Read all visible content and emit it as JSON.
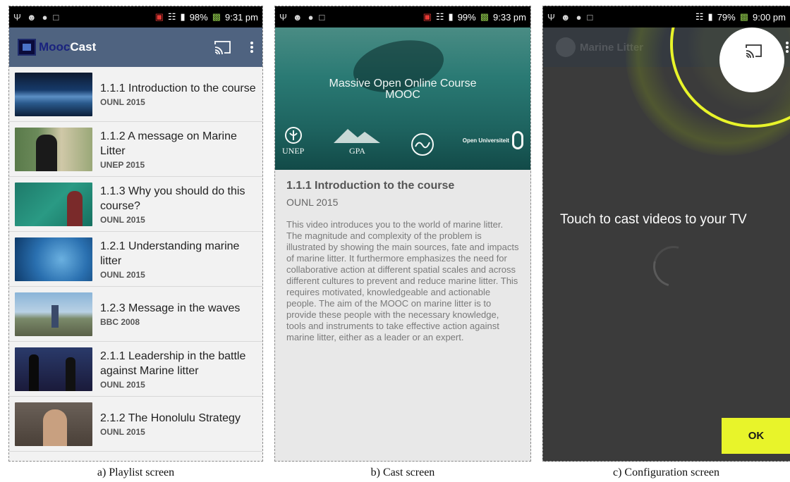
{
  "screens": {
    "playlist": {
      "status": {
        "battery": "98%",
        "time": "9:31 pm"
      },
      "app": {
        "name_part1": "Mooc",
        "name_part2": "Cast"
      },
      "items": [
        {
          "title": "1.1.1 Introduction to the course",
          "source": "OUNL 2015"
        },
        {
          "title": "1.1.2 A message on Marine Litter",
          "source": "UNEP 2015"
        },
        {
          "title": "1.1.3 Why you should do this course?",
          "source": "OUNL 2015"
        },
        {
          "title": "1.2.1 Understanding marine litter",
          "source": "OUNL 2015"
        },
        {
          "title": "1.2.3 Message in the waves",
          "source": "BBC 2008"
        },
        {
          "title": "2.1.1 Leadership in the battle against Marine litter",
          "source": "OUNL 2015"
        },
        {
          "title": "2.1.2 The Honolulu Strategy",
          "source": "OUNL 2015"
        }
      ]
    },
    "cast": {
      "status": {
        "battery": "99%",
        "time": "9:33 pm"
      },
      "hero": {
        "title_line1": "Massive Open Online  Course",
        "title_line2": "MOOC",
        "logos": [
          "UNEP",
          "GPA",
          "Open Universiteit"
        ]
      },
      "title": "1.1.1 Introduction to the course",
      "source": "OUNL 2015",
      "description": "This video introduces you to the world of marine litter. The magnitude and complexity of the problem is illustrated by showing the main sources, fate and impacts of marine litter. It furthermore emphasizes the need for collaborative action at different spatial scales and across different cultures to prevent and reduce marine litter. This requires motivated, knowledgeable and actionable people. The aim of the MOOC on marine litter is to provide these people with the necessary knowledge, tools and instruments to take effective action against marine litter, either as a leader or an expert."
    },
    "config": {
      "status": {
        "battery": "79%",
        "time": "9:00 pm"
      },
      "app_title": "Marine Litter",
      "message": "Touch to cast videos to your TV",
      "ok_label": "OK"
    }
  },
  "captions": [
    "a) Playlist screen",
    "b) Cast screen",
    "c) Configuration screen"
  ],
  "colors": {
    "appbar": "#4f6380",
    "accent_yellow": "#e8f42a",
    "config_bg": "#3b3b3b"
  },
  "icons": [
    "cast-icon",
    "more-vert-icon",
    "usb-icon",
    "android-icon",
    "signal-icon",
    "wifi-icon",
    "battery-icon"
  ]
}
